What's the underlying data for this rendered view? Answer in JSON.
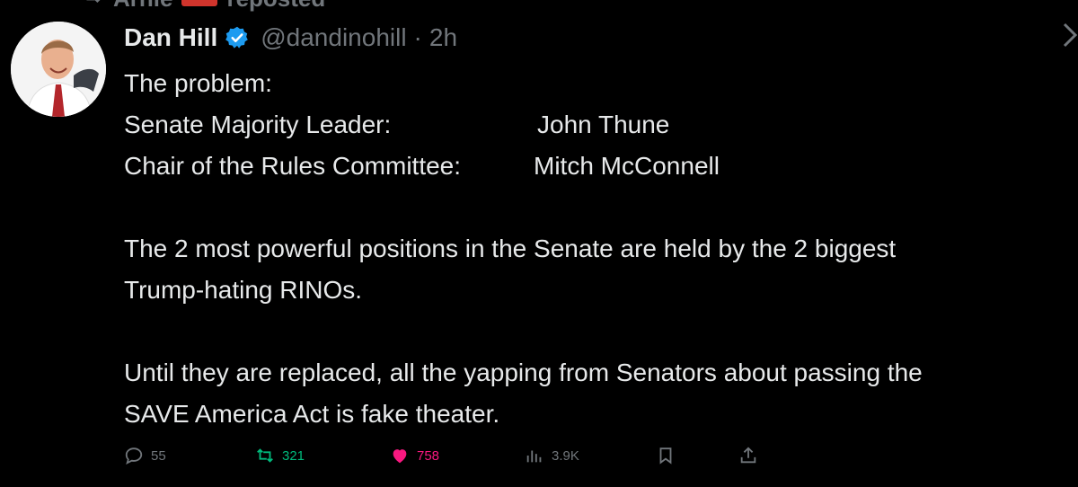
{
  "repost_banner": {
    "user": "Arnie",
    "label": "reposted"
  },
  "tweet": {
    "author_name": "Dan Hill",
    "handle": "@dandinohill",
    "separator": "·",
    "time": "2h",
    "intro": "The problem:",
    "rows": [
      {
        "label": "Senate Majority Leader:",
        "value": "John Thune"
      },
      {
        "label": "Chair of the Rules Committee:",
        "value": "Mitch McConnell"
      }
    ],
    "paragraph1": [
      "The 2 most powerful positions in the Senate are held by the 2 biggest",
      "Trump-hating RINOs."
    ],
    "paragraph2": [
      "Until they are replaced, all the yapping from Senators about passing the",
      "SAVE America Act is fake theater."
    ]
  },
  "actions": {
    "replies": "55",
    "reposts": "321",
    "likes": "758",
    "views": "3.9K"
  },
  "colors": {
    "background": "#000000",
    "text": "#e7e9ea",
    "muted": "#71767b",
    "verified": "#1d9bf0",
    "repost_green": "#00ba7c",
    "like_pink": "#f91880"
  },
  "icons": [
    "repost-icon",
    "verified-icon",
    "chevron-right-icon",
    "reply-icon",
    "retweet-icon",
    "heart-icon",
    "views-icon",
    "bookmark-icon",
    "share-icon"
  ]
}
